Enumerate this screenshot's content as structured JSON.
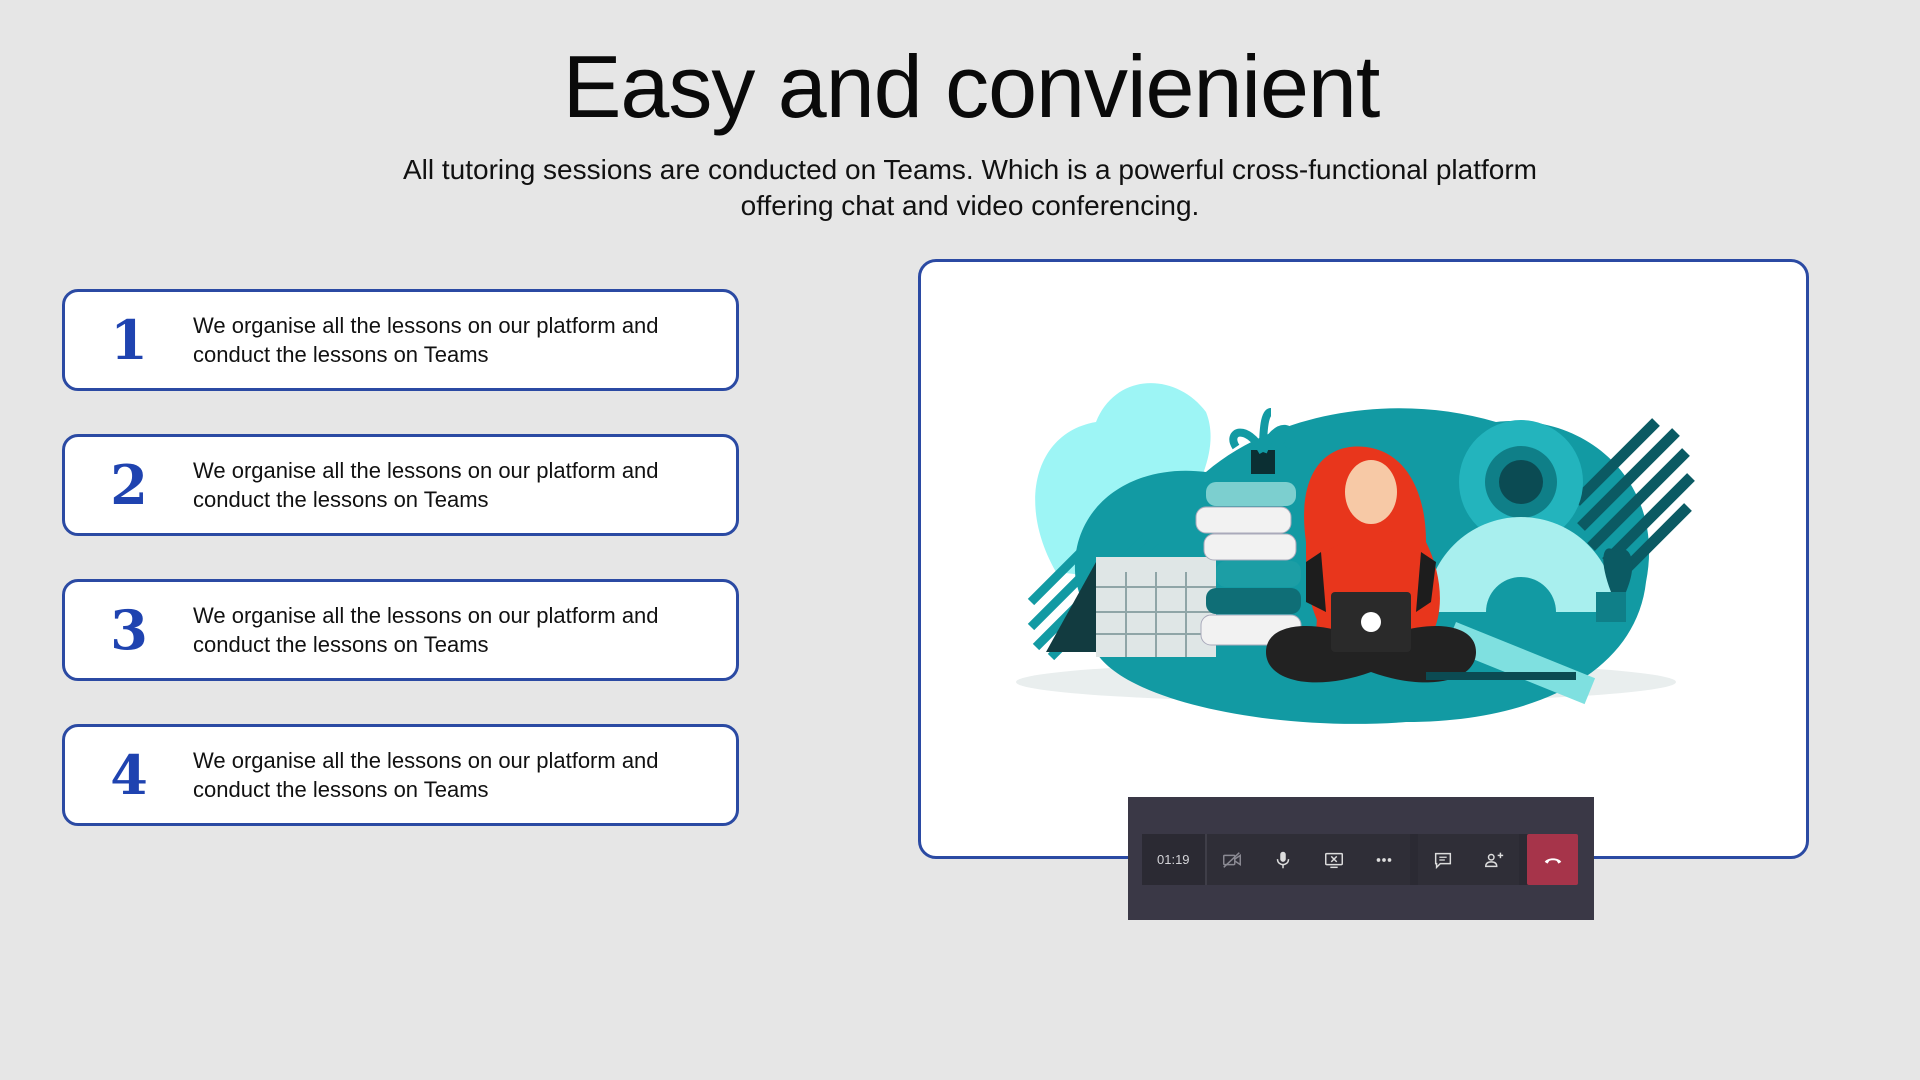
{
  "header": {
    "title": "Easy and convienient",
    "subtitle": "All tutoring sessions are conducted on Teams. Which is a powerful cross-functional platform offering chat and video conferencing."
  },
  "steps": [
    {
      "number": "1",
      "text": "We organise all the lessons on our platform and conduct the lessons on Teams"
    },
    {
      "number": "2",
      "text": "We organise all the lessons on our platform and conduct the lessons on Teams"
    },
    {
      "number": "3",
      "text": "We organise all the lessons on our platform and conduct the lessons on Teams"
    },
    {
      "number": "4",
      "text": "We organise all the lessons on our platform and conduct the lessons on Teams"
    }
  ],
  "call_bar": {
    "timer": "01:19",
    "buttons": [
      "video-off-icon",
      "microphone-icon",
      "stop-share-icon",
      "more-options-icon",
      "chat-icon",
      "participants-icon",
      "hang-up-icon"
    ],
    "hangup_color": "#a6344a"
  },
  "colors": {
    "accent": "#2b4aa3",
    "number": "#1f43b0",
    "background": "#e6e6e6",
    "teal": "#0e8f98",
    "hair": "#e8361c"
  }
}
